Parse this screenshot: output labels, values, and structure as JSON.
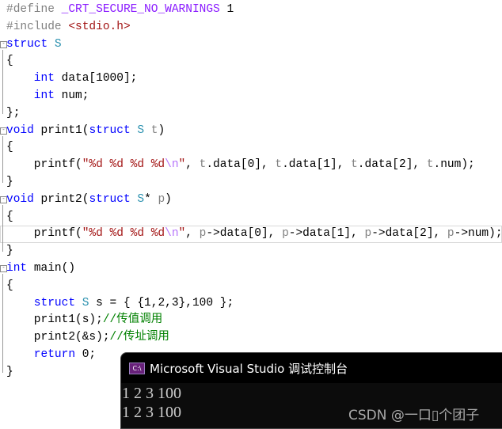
{
  "code_lines": [
    [
      [
        "#define ",
        "p"
      ],
      [
        "_CRT_SECURE_NO_WARNINGS",
        "m"
      ],
      [
        " 1",
        "n"
      ]
    ],
    [
      [
        "#include ",
        "p"
      ],
      [
        "<stdio.h>",
        "s"
      ]
    ],
    [
      [
        "struct ",
        "k"
      ],
      [
        "S",
        "t"
      ]
    ],
    [
      [
        "{",
        "n"
      ]
    ],
    [
      [
        "    int ",
        "k"
      ],
      [
        "data[1000];",
        "n"
      ]
    ],
    [
      [
        "    int ",
        "k"
      ],
      [
        "num;",
        "n"
      ]
    ],
    [
      [
        "};",
        "n"
      ]
    ],
    [
      [
        "void ",
        "k"
      ],
      [
        "print1(",
        "n"
      ],
      [
        "struct ",
        "k"
      ],
      [
        "S ",
        "t"
      ],
      [
        "t",
        "v"
      ],
      [
        ")",
        "n"
      ]
    ],
    [
      [
        "{",
        "n"
      ]
    ],
    [
      [
        "    printf(",
        "n"
      ],
      [
        "\"%d %d %d %d",
        "s"
      ],
      [
        "\\n",
        "e"
      ],
      [
        "\"",
        "s"
      ],
      [
        ", ",
        "n"
      ],
      [
        "t",
        "v"
      ],
      [
        ".data[0], ",
        "n"
      ],
      [
        "t",
        "v"
      ],
      [
        ".data[1], ",
        "n"
      ],
      [
        "t",
        "v"
      ],
      [
        ".data[2], ",
        "n"
      ],
      [
        "t",
        "v"
      ],
      [
        ".num);",
        "n"
      ]
    ],
    [
      [
        "}",
        "n"
      ]
    ],
    [
      [
        "void ",
        "k"
      ],
      [
        "print2(",
        "n"
      ],
      [
        "struct ",
        "k"
      ],
      [
        "S",
        "t"
      ],
      [
        "* ",
        "n"
      ],
      [
        "p",
        "v"
      ],
      [
        ")",
        "n"
      ]
    ],
    [
      [
        "{",
        "n"
      ]
    ],
    [
      [
        "    printf(",
        "n"
      ],
      [
        "\"%d %d %d %d",
        "s"
      ],
      [
        "\\n",
        "e"
      ],
      [
        "\"",
        "s"
      ],
      [
        ", ",
        "n"
      ],
      [
        "p",
        "v"
      ],
      [
        "->data[0], ",
        "n"
      ],
      [
        "p",
        "v"
      ],
      [
        "->data[1], ",
        "n"
      ],
      [
        "p",
        "v"
      ],
      [
        "->data[2], ",
        "n"
      ],
      [
        "p",
        "v"
      ],
      [
        "->num);",
        "n"
      ]
    ],
    [
      [
        "}",
        "n"
      ]
    ],
    [
      [
        "int ",
        "k"
      ],
      [
        "main()",
        "n"
      ]
    ],
    [
      [
        "{",
        "n"
      ]
    ],
    [
      [
        "    struct ",
        "k"
      ],
      [
        "S ",
        "t"
      ],
      [
        "s = { {1,2,3},100 };",
        "n"
      ]
    ],
    [
      [
        "    print1(s);",
        "n"
      ],
      [
        "//传值调用",
        "c"
      ]
    ],
    [
      [
        "    print2(&s);",
        "n"
      ],
      [
        "//传址调用",
        "c"
      ]
    ],
    [
      [
        "    return ",
        "k"
      ],
      [
        "0;",
        "n"
      ]
    ],
    [
      [
        "}",
        "n"
      ]
    ]
  ],
  "console": {
    "title": "Microsoft Visual Studio 调试控制台",
    "icon": "C:\\",
    "output": [
      "1 2 3 100",
      "1 2 3 100"
    ]
  },
  "watermark": "CSDN @一口\u0000个团子"
}
